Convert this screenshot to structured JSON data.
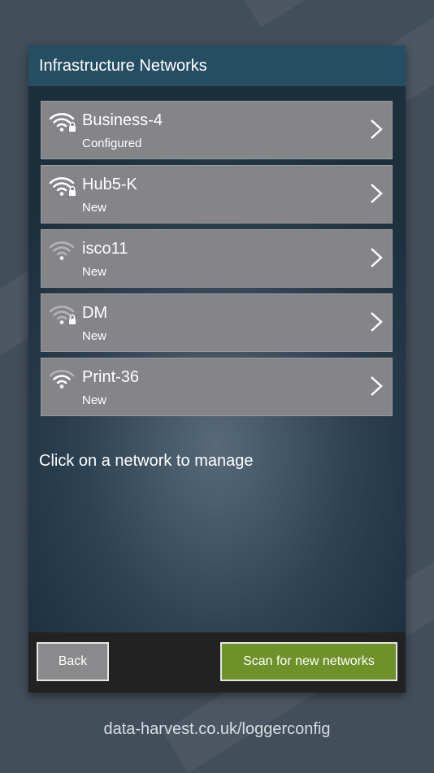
{
  "header": {
    "title": "Infrastructure Networks"
  },
  "networks": [
    {
      "name": "Business-4",
      "status": "Configured",
      "signal": "wifi-strong-locked-icon"
    },
    {
      "name": "Hub5-K",
      "status": "New",
      "signal": "wifi-strong-locked-icon"
    },
    {
      "name": "isco11",
      "status": "New",
      "signal": "wifi-weak-icon"
    },
    {
      "name": "DM",
      "status": "New",
      "signal": "wifi-weak-locked-icon"
    },
    {
      "name": "Print-36",
      "status": "New",
      "signal": "wifi-medium-icon"
    }
  ],
  "hint": "Click on a network to manage",
  "footer": {
    "back_label": "Back",
    "scan_label": "Scan for new networks"
  },
  "url": "data-harvest.co.uk/loggerconfig",
  "colors": {
    "header": "#254e62",
    "item": "#858489",
    "scan_button": "#6f912a",
    "back_button": "#8a8a8c"
  }
}
